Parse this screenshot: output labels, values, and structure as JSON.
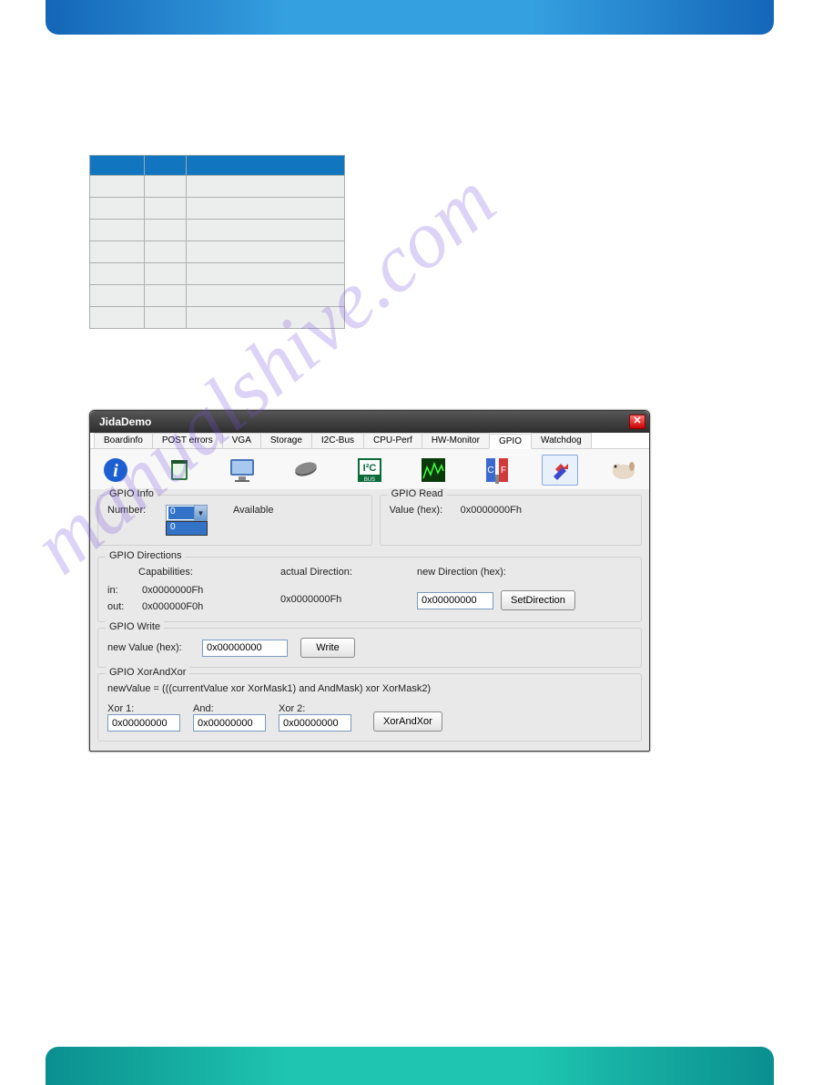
{
  "watermark": "manualshive.com",
  "table": {
    "headers": [
      "",
      "",
      ""
    ],
    "rows": [
      [
        "",
        "",
        ""
      ],
      [
        "",
        "",
        ""
      ],
      [
        "",
        "",
        ""
      ],
      [
        "",
        "",
        ""
      ],
      [
        "",
        "",
        ""
      ],
      [
        "",
        "",
        ""
      ],
      [
        "",
        "",
        ""
      ]
    ]
  },
  "window": {
    "title": "JidaDemo",
    "tabs": [
      "Boardinfo",
      "POST errors",
      "VGA",
      "Storage",
      "I2C-Bus",
      "CPU-Perf",
      "HW-Monitor",
      "GPIO",
      "Watchdog"
    ],
    "active_tab_index": 7,
    "gpio_info": {
      "legend": "GPIO Info",
      "number_label": "Number:",
      "number_value": "0",
      "dropdown_option": "0",
      "available_label": "Available"
    },
    "gpio_read": {
      "legend": "GPIO Read",
      "value_label": "Value (hex):",
      "value": "0x0000000Fh"
    },
    "gpio_directions": {
      "legend": "GPIO Directions",
      "capabilities_label": "Capabilities:",
      "in_label": "in:",
      "in_value": "0x0000000Fh",
      "out_label": "out:",
      "out_value": "0x000000F0h",
      "actual_label": "actual Direction:",
      "actual_value": "0x0000000Fh",
      "new_label": "new Direction (hex):",
      "new_value": "0x00000000",
      "set_button": "SetDirection"
    },
    "gpio_write": {
      "legend": "GPIO Write",
      "new_value_label": "new Value (hex):",
      "new_value": "0x00000000",
      "write_button": "Write"
    },
    "gpio_xax": {
      "legend": "GPIO XorAndXor",
      "formula": "newValue = (((currentValue xor XorMask1) and AndMask) xor XorMask2)",
      "xor1_label": "Xor 1:",
      "xor1_value": "0x00000000",
      "and_label": "And:",
      "and_value": "0x00000000",
      "xor2_label": "Xor 2:",
      "xor2_value": "0x00000000",
      "button": "XorAndXor"
    }
  }
}
